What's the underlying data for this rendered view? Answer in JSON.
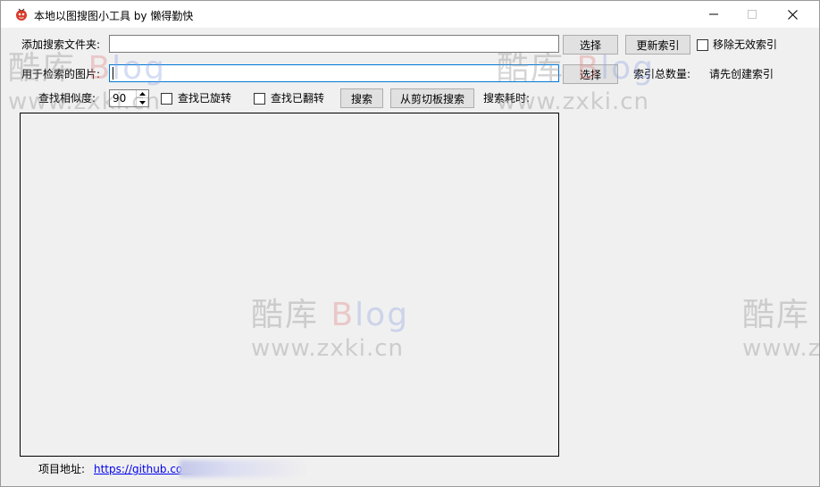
{
  "window": {
    "title": "本地以图搜图小工具 by 懒得勤快",
    "controls": {
      "minimize_icon": "minimize-icon",
      "maximize_icon": "maximize-icon",
      "close_icon": "close-icon"
    }
  },
  "form": {
    "folder_label": "添加搜索文件夹:",
    "folder_value": "",
    "folder_select_label": "选择",
    "update_index_label": "更新索引",
    "remove_invalid_label": "移除无效索引",
    "image_label": "用于检索的图片:",
    "image_value": "",
    "image_select_label": "选择",
    "index_count_label": "索引总数量:",
    "index_count_value": "请先创建索引",
    "similarity_label": "查找相似度:",
    "similarity_value": "90",
    "find_rotated_label": "查找已旋转",
    "find_flipped_label": "查找已翻转",
    "search_label": "搜索",
    "clipboard_search_label": "从剪切板搜索",
    "search_time_label": "搜索耗时:"
  },
  "footer": {
    "project_label": "项目地址:",
    "project_link": "https://github.com"
  },
  "watermark": {
    "logo_cn": "酷库",
    "logo_blog": "Blog",
    "url": "www.zxki.cn"
  },
  "colors": {
    "accent": "#0078d7",
    "link": "#0000ee",
    "background": "#f0f0f0"
  }
}
